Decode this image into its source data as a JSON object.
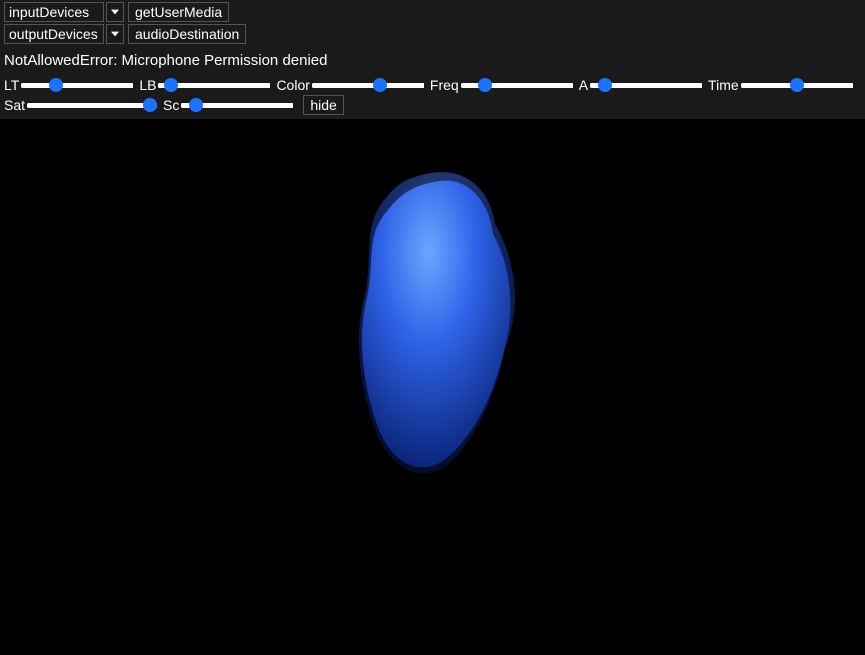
{
  "toolbar": {
    "input_devices": {
      "selected": "inputDevices"
    },
    "output_devices": {
      "selected": "outputDevices"
    },
    "get_user_media_label": "getUserMedia",
    "audio_destination_label": "audioDestination"
  },
  "error_message": "NotAllowedError: Microphone Permission denied",
  "sliders": {
    "lt": {
      "label": "LT",
      "value": 28,
      "min": 0,
      "max": 100
    },
    "lb": {
      "label": "LB",
      "value": 6,
      "min": 0,
      "max": 100
    },
    "color": {
      "label": "Color",
      "value": 62,
      "min": 0,
      "max": 100
    },
    "freq": {
      "label": "Freq",
      "value": 18,
      "min": 0,
      "max": 100
    },
    "a": {
      "label": "A",
      "value": 8,
      "min": 0,
      "max": 100
    },
    "time": {
      "label": "Time",
      "value": 50,
      "min": 0,
      "max": 100
    },
    "sat": {
      "label": "Sat",
      "value": 100,
      "min": 0,
      "max": 100
    },
    "sc": {
      "label": "Sc",
      "value": 8,
      "min": 0,
      "max": 100
    }
  },
  "hide_button_label": "hide",
  "colors": {
    "accent": "#1a73ff",
    "blob_light": "#6aa7ff",
    "blob_mid": "#2f63e8",
    "blob_dark": "#0b2fa8"
  }
}
